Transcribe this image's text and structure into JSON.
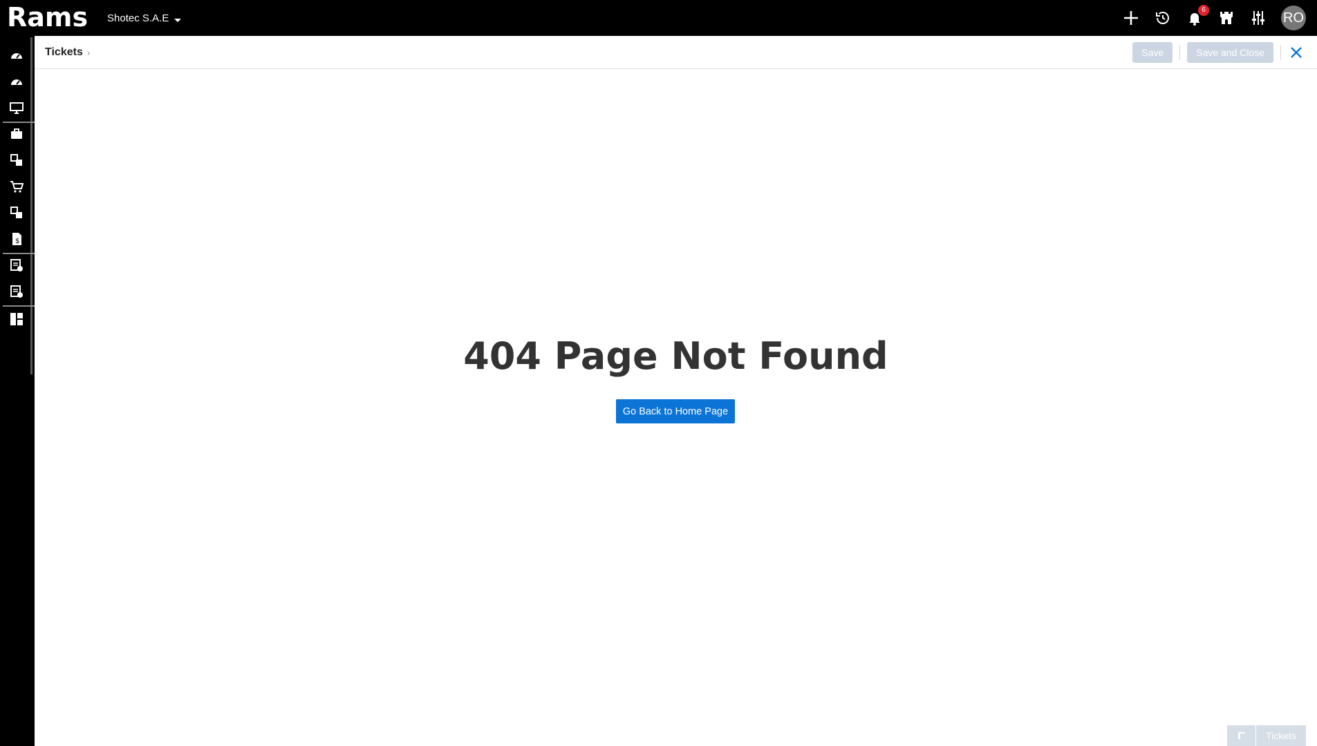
{
  "app": {
    "logo_text": "Rams",
    "company": "Shotec S.A.E",
    "notifications_count": "6",
    "user_initials": "RO"
  },
  "subheader": {
    "breadcrumb": "Tickets",
    "save_label": "Save",
    "save_close_label": "Save and Close"
  },
  "main": {
    "title": "404 Page Not Found",
    "home_button": "Go Back to Home Page"
  },
  "dock": {
    "label": "Tickets"
  },
  "colors": {
    "primary": "#0c74d6",
    "topbar": "#000000",
    "badge": "#e0242f",
    "disabled_button": "#ccd6e2"
  }
}
